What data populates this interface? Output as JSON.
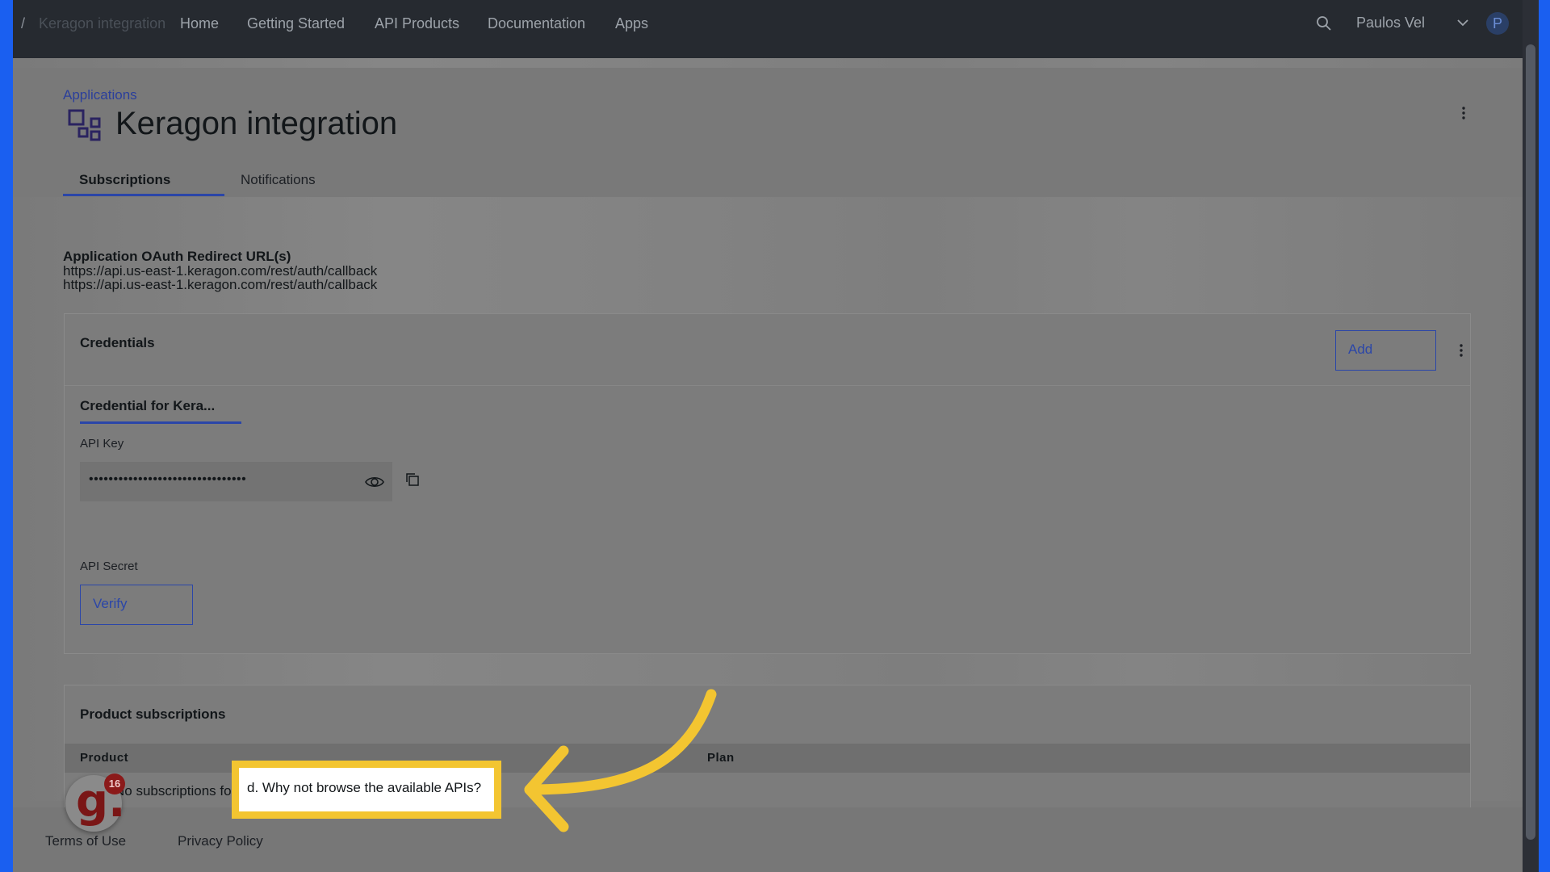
{
  "nav": {
    "slash": "/",
    "app_crumb": "Keragon integration",
    "links": [
      "Home",
      "Getting Started",
      "API Products",
      "Documentation",
      "Apps"
    ],
    "user_name": "Paulos Vel",
    "avatar_initial": "P"
  },
  "page": {
    "breadcrumb": "Applications",
    "title": "Keragon integration",
    "tabs": {
      "subscriptions": "Subscriptions",
      "notifications": "Notifications"
    }
  },
  "redirect": {
    "title": "Application OAuth Redirect URL(s)",
    "urls": [
      "https://api.us-east-1.keragon.com/rest/auth/callback",
      "https://api.us-east-1.keragon.com/rest/auth/callback"
    ]
  },
  "credentials": {
    "title": "Credentials",
    "add_label": "Add",
    "tab_label": "Credential for Kera...",
    "api_key_label": "API Key",
    "api_key_masked": "••••••••••••••••••••••••••••••••",
    "api_secret_label": "API Secret",
    "verify_label": "Verify"
  },
  "products": {
    "title": "Product subscriptions",
    "col_product": "Product",
    "col_plan": "Plan",
    "empty_prefix": "No subscriptions four",
    "empty_highlight": "d. Why not browse the available APIs?"
  },
  "footer": {
    "terms": "Terms of Use",
    "privacy": "Privacy Policy"
  },
  "guide": {
    "badge_count": "16",
    "logo_letter": "g."
  },
  "colors": {
    "accent": "#2b46a8",
    "highlight": "#f3c531",
    "arrow": "#f3c531",
    "badge": "#8b1a1a"
  }
}
